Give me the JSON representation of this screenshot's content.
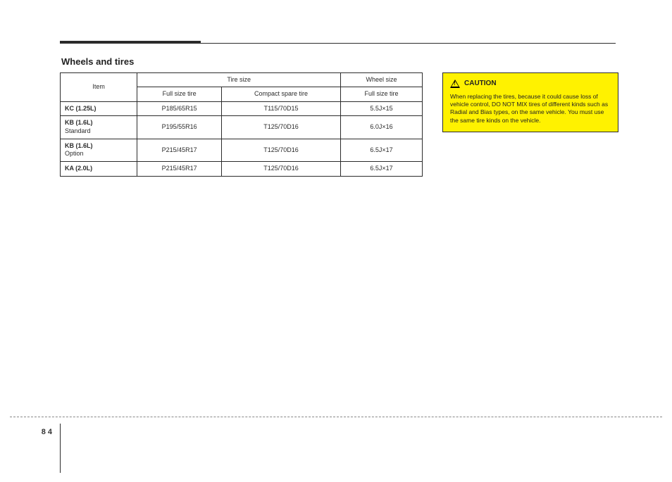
{
  "section_title": "Wheels and tires",
  "callout": {
    "label": "CAUTION",
    "body": "When replacing the tires, because it could cause loss of vehicle control, DO NOT MIX tires of different kinds such as Radial and Bias types, on the same vehicle. You must use the same tire kinds on the vehicle."
  },
  "table": {
    "col0_header": "Item",
    "header_top": [
      "Tire size",
      "Wheel size"
    ],
    "header_sub": [
      "Full size tire",
      "Compact spare tire",
      "Full size tire"
    ],
    "rows": [
      {
        "label_strong": "KC (1.25L)",
        "label_sub": "",
        "cells": [
          "P185/65R15",
          "T115/70D15",
          "5.5J×15"
        ]
      },
      {
        "label_strong": "KB (1.6L)",
        "label_sub": "Standard",
        "cells": [
          "P195/55R16",
          "T125/70D16",
          "6.0J×16"
        ]
      },
      {
        "label_strong": "KB (1.6L)",
        "label_sub": "Option",
        "cells": [
          "P215/45R17",
          "T125/70D16",
          "6.5J×17"
        ]
      },
      {
        "label_strong": "KA (2.0L)",
        "label_sub": "",
        "cells": [
          "P215/45R17",
          "T125/70D16",
          "6.5J×17"
        ]
      }
    ]
  },
  "chart_data": {
    "type": "table",
    "title": "Wheels and tires",
    "columns": [
      "Item",
      "Full size tire (Tire size)",
      "Compact spare tire (Tire size)",
      "Full size tire (Wheel size)"
    ],
    "rows": [
      [
        "KC (1.25L)",
        "P185/65R15",
        "T115/70D15",
        "5.5J×15"
      ],
      [
        "KB (1.6L) Standard",
        "P195/55R16",
        "T125/70D16",
        "6.0J×16"
      ],
      [
        "KB (1.6L) Option",
        "P215/45R17",
        "T125/70D16",
        "6.5J×17"
      ],
      [
        "KA (2.0L)",
        "P215/45R17",
        "T125/70D16",
        "6.5J×17"
      ]
    ]
  },
  "footer": {
    "page": "8 4"
  }
}
